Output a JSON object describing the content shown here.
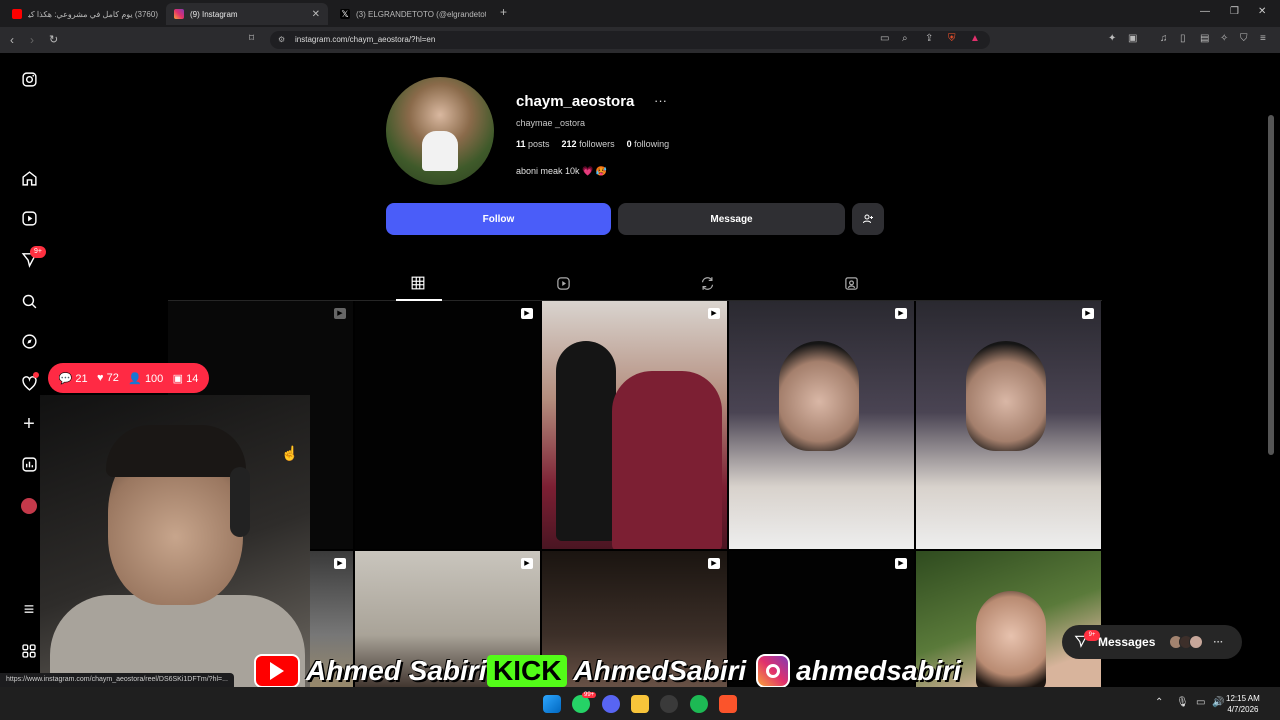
{
  "browser": {
    "tabs": [
      {
        "label": "(3760) يوم كامل في مشروعي: هكذا كيد",
        "active": false,
        "favicon_color": "#ff0000"
      },
      {
        "label": "(9) Instagram",
        "active": true,
        "favicon_color": "#e1306c"
      },
      {
        "label": "(3) ELGRANDETOTO (@elgrandetoto)",
        "active": false,
        "favicon_color": "#ffffff"
      }
    ],
    "new_tab_symbol": "+",
    "url": "instagram.com/chaym_aeostora/?hl=en"
  },
  "sidebar": {
    "items": [
      {
        "name": "instagram-icon",
        "glyph": "◎"
      },
      {
        "name": "home-icon",
        "glyph": "⌂"
      },
      {
        "name": "reels-icon",
        "glyph": "▷"
      },
      {
        "name": "direct-icon",
        "glyph": "✈"
      },
      {
        "name": "search-icon",
        "glyph": "⌕"
      },
      {
        "name": "explore-icon",
        "glyph": "◉"
      },
      {
        "name": "notifications-icon",
        "glyph": "♡"
      },
      {
        "name": "create-icon",
        "glyph": "+"
      },
      {
        "name": "dashboard-icon",
        "glyph": "▥"
      },
      {
        "name": "profile-icon",
        "glyph": "●"
      },
      {
        "name": "menu-icon",
        "glyph": "≡"
      },
      {
        "name": "meta-icon",
        "glyph": "⊞"
      }
    ],
    "direct_badge": "9+"
  },
  "profile": {
    "username": "chaym_aeostora",
    "more": "···",
    "fullname": "chaymae _ostora",
    "posts_count": "11",
    "posts_label": "posts",
    "followers_count": "212",
    "followers_label": "followers",
    "following_count": "0",
    "following_label": "following",
    "bio": "aboni meak 10k 💗 🥵"
  },
  "actions": {
    "follow": "Follow",
    "message": "Message",
    "add_user": "👤+"
  },
  "profile_tabs": [
    "posts-tab",
    "reels-tab",
    "reposts-tab",
    "tagged-tab"
  ],
  "notification_pill": {
    "comments": "21",
    "likes": "72",
    "followers": "100",
    "users": "14"
  },
  "messages_pill": {
    "label": "Messages",
    "badge": "9+"
  },
  "streamer_banner": {
    "youtube_name": "Ahmed Sabiri",
    "kick_label": "KICK",
    "kick_name": "AhmedSabiri",
    "instagram_name": "ahmedsabiri"
  },
  "status_url": "https://www.instagram.com/chaym_aeostora/reel/DS6SKi1DFTm/?hl=...",
  "taskbar": {
    "whatsapp_badge": "99+",
    "time": "12:15 AM",
    "date": "4/7/2026"
  },
  "colors": {
    "accent": "#4a5df9",
    "notification": "#ff2a44"
  }
}
